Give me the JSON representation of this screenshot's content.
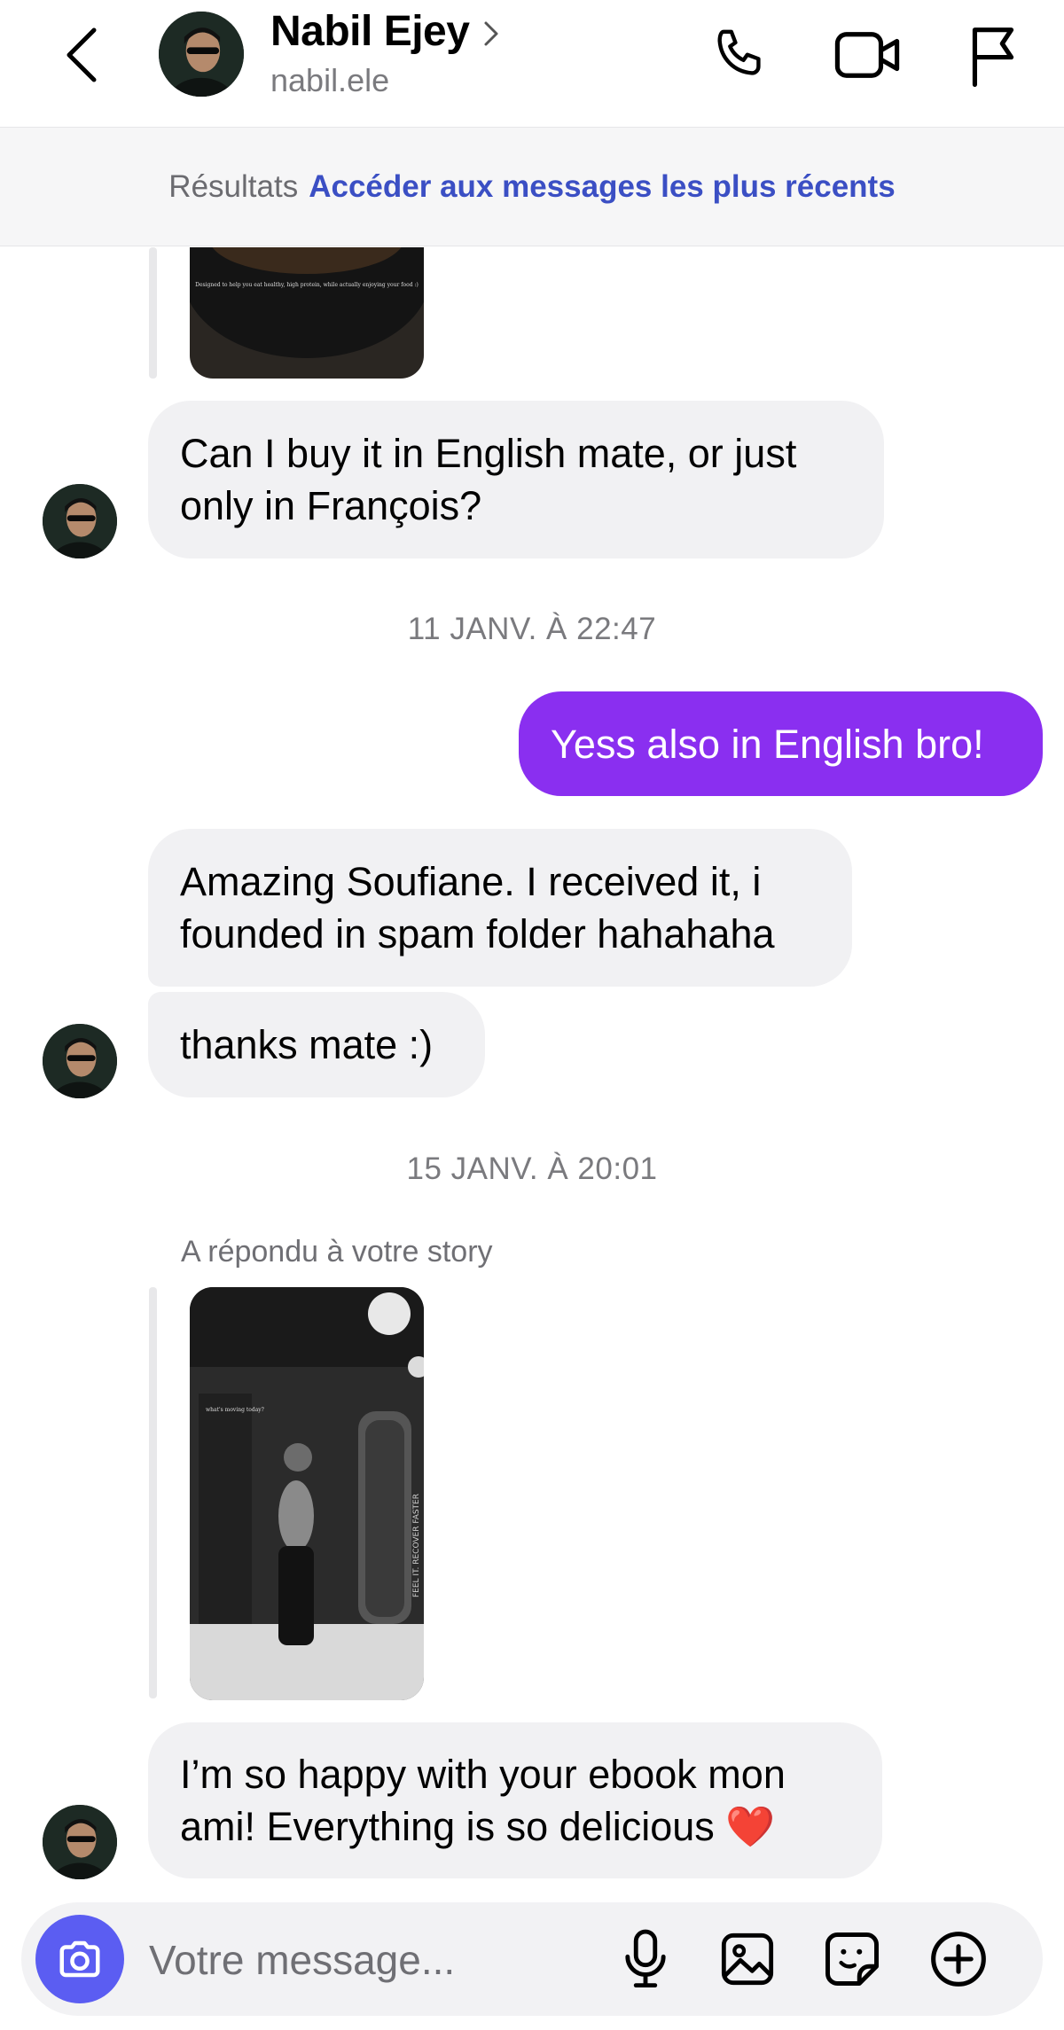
{
  "header": {
    "contact_name": "Nabil Ejey",
    "contact_handle": "nabil.ele"
  },
  "results_bar": {
    "label": "Résultats",
    "link": "Accéder aux messages les plus récents"
  },
  "messages": {
    "m1": "Can I buy it in English mate, or just only in François?",
    "ts1": "11 JANV. À 22:47",
    "m2": "Yess also in English bro!",
    "m3": "Amazing Soufiane. I received it, i founded in spam folder hahahaha",
    "m4": "thanks mate :)",
    "ts2": "15 JANV. À 20:01",
    "replied_label": "A répondu à votre story",
    "m5": "I’m so happy with your ebook mon ami! Everything is so delicious ❤️"
  },
  "stories": {
    "story1_caption": "Designed to help you eat healthy, high protein, while actually enjoying your food :)",
    "story2_caption": "what's moving today?",
    "story2_side_text": "FEEL IT. RECOVER FASTER"
  },
  "composer": {
    "placeholder": "Votre message..."
  },
  "icons": {
    "back": "chevron-left-icon",
    "phone": "phone-icon",
    "video": "video-camera-icon",
    "flag": "flag-icon",
    "camera": "camera-icon",
    "mic": "microphone-icon",
    "gallery": "image-icon",
    "sticker": "sticker-icon",
    "plus": "plus-circle-icon"
  },
  "colors": {
    "outgoing_bubble": "#8a2ff0",
    "incoming_bubble": "#f1f1f3",
    "link": "#3b4fc4",
    "camera_button": "#5b5df2"
  }
}
